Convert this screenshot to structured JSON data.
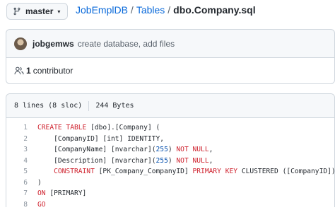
{
  "branch": {
    "label": "master",
    "icon": "git-branch-icon",
    "caret": "▾"
  },
  "breadcrumb": {
    "repo": "JobEmplDB",
    "folder": "Tables",
    "separator": "/",
    "file": "dbo.Company.sql"
  },
  "commit": {
    "avatar_icon": "avatar",
    "author": "jobgemws",
    "message": "create database, add files"
  },
  "contributors": {
    "icon": "people-icon",
    "count": "1",
    "label": "contributor"
  },
  "file_info": {
    "lines": "8 lines (8 sloc)",
    "size": "244 Bytes"
  },
  "code": {
    "lines": [
      {
        "n": "1",
        "parts": [
          [
            "kw",
            "CREATE TABLE "
          ],
          [
            "",
            "[dbo].[Company] ("
          ]
        ]
      },
      {
        "n": "2",
        "parts": [
          [
            "",
            "    [CompanyID] [int] IDENTITY,"
          ]
        ]
      },
      {
        "n": "3",
        "parts": [
          [
            "",
            "    [CompanyName] [nvarchar]("
          ],
          [
            "num",
            "255"
          ],
          [
            "",
            ") "
          ],
          [
            "kw",
            "NOT NULL"
          ],
          [
            "",
            ","
          ]
        ]
      },
      {
        "n": "4",
        "parts": [
          [
            "",
            "    [Description] [nvarchar]("
          ],
          [
            "num",
            "255"
          ],
          [
            "",
            ") "
          ],
          [
            "kw",
            "NOT NULL"
          ],
          [
            "",
            ","
          ]
        ]
      },
      {
        "n": "5",
        "parts": [
          [
            "kw",
            "    CONSTRAINT"
          ],
          [
            "",
            " [PK_Company_CompanyID] "
          ],
          [
            "kw",
            "PRIMARY KEY"
          ],
          [
            "",
            " CLUSTERED ([CompanyID])"
          ]
        ]
      },
      {
        "n": "6",
        "parts": [
          [
            "",
            ")"
          ]
        ]
      },
      {
        "n": "7",
        "parts": [
          [
            "kw",
            "ON"
          ],
          [
            "",
            " [PRIMARY]"
          ]
        ]
      },
      {
        "n": "8",
        "parts": [
          [
            "kw",
            "GO"
          ]
        ]
      }
    ]
  },
  "colors": {
    "link": "#0969da",
    "keyword": "#cf222e",
    "number": "#0550ae",
    "border": "#d0d7de",
    "header_bg": "#f6f8fa"
  }
}
